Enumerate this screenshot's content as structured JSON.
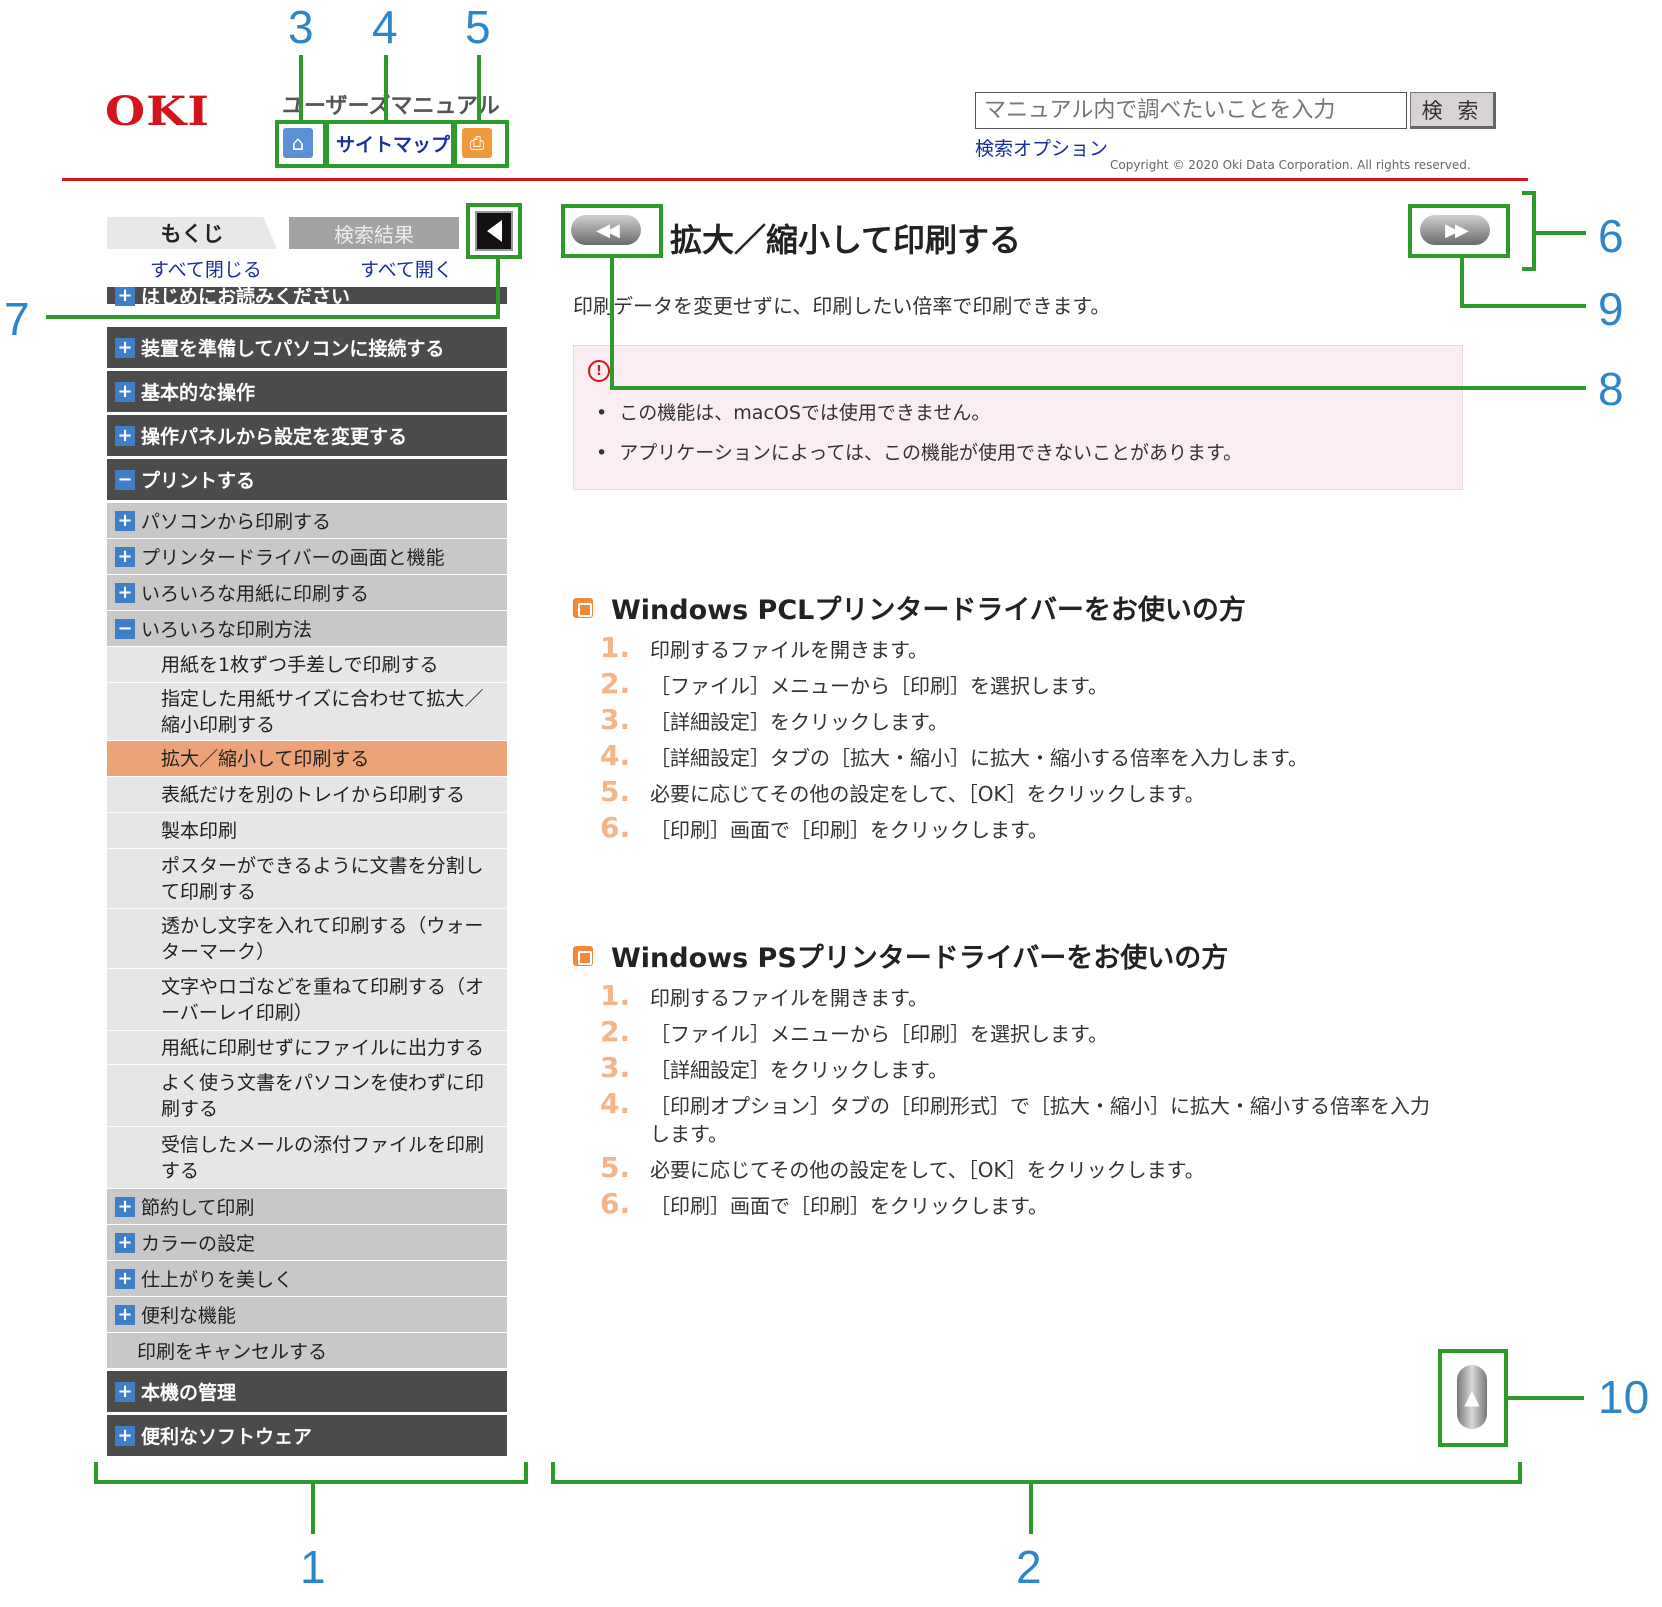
{
  "header": {
    "logo": "OKI",
    "manual_title": "ユーザーズマニュアル",
    "home_icon": "home-icon",
    "sitemap": "サイトマップ",
    "print_icon": "print-icon",
    "search_placeholder": "マニュアル内で調べたいことを入力",
    "search_button": "検 索",
    "search_options": "検索オプション",
    "copyright": "Copyright © 2020 Oki Data Corporation. All rights reserved."
  },
  "sidebar": {
    "tab_toc": "もくじ",
    "tab_search": "検索結果",
    "close_all": "すべて閉じる",
    "open_all": "すべて開く",
    "items": [
      {
        "level": 1,
        "exp": "+",
        "label": "はじめにお読みください"
      },
      {
        "level": 1,
        "exp": "+",
        "label": "装置を準備してパソコンに接続する"
      },
      {
        "level": 1,
        "exp": "+",
        "label": "基本的な操作"
      },
      {
        "level": 1,
        "exp": "+",
        "label": "操作パネルから設定を変更する"
      },
      {
        "level": 1,
        "exp": "−",
        "label": "プリントする"
      },
      {
        "level": 2,
        "exp": "+",
        "label": "パソコンから印刷する"
      },
      {
        "level": 2,
        "exp": "+",
        "label": "プリンタードライバーの画面と機能"
      },
      {
        "level": 2,
        "exp": "+",
        "label": "いろいろな用紙に印刷する"
      },
      {
        "level": 2,
        "exp": "−",
        "label": "いろいろな印刷方法"
      },
      {
        "level": 3,
        "label": "用紙を1枚ずつ手差しで印刷する"
      },
      {
        "level": 3,
        "label": "指定した用紙サイズに合わせて拡大／縮小印刷する"
      },
      {
        "level": 3,
        "label": "拡大／縮小して印刷する",
        "active": true
      },
      {
        "level": 3,
        "label": "表紙だけを別のトレイから印刷する"
      },
      {
        "level": 3,
        "label": "製本印刷"
      },
      {
        "level": 3,
        "label": "ポスターができるように文書を分割して印刷する"
      },
      {
        "level": 3,
        "label": "透かし文字を入れて印刷する（ウォーターマーク）"
      },
      {
        "level": 3,
        "label": "文字やロゴなどを重ねて印刷する（オーバーレイ印刷）"
      },
      {
        "level": 3,
        "label": "用紙に印刷せずにファイルに出力する"
      },
      {
        "level": 3,
        "label": "よく使う文書をパソコンを使わずに印刷する"
      },
      {
        "level": 3,
        "label": "受信したメールの添付ファイルを印刷する"
      },
      {
        "level": 2,
        "exp": "+",
        "label": "節約して印刷"
      },
      {
        "level": 2,
        "exp": "+",
        "label": "カラーの設定"
      },
      {
        "level": 2,
        "exp": "+",
        "label": "仕上がりを美しく"
      },
      {
        "level": 2,
        "exp": "+",
        "label": "便利な機能"
      },
      {
        "level": 2,
        "label": "印刷をキャンセルする"
      },
      {
        "level": 1,
        "exp": "+",
        "label": "本機の管理"
      },
      {
        "level": 1,
        "exp": "+",
        "label": "便利なソフトウェア"
      }
    ]
  },
  "main": {
    "title": "拡大／縮小して印刷する",
    "intro": "印刷データを変更せずに、印刷したい倍率で印刷できます。",
    "notes": [
      "この機能は、macOSでは使用できません。",
      "アプリケーションによっては、この機能が使用できないことがあります。"
    ],
    "sections": [
      {
        "heading": "Windows PCLプリンタードライバーをお使いの方",
        "steps": [
          {
            "num": "1.",
            "text": "印刷するファイルを開きます。"
          },
          {
            "num": "2.",
            "text": "［ファイル］メニューから［印刷］を選択します。"
          },
          {
            "num": "3.",
            "text": "［詳細設定］をクリックします。"
          },
          {
            "num": "4.",
            "text": "［詳細設定］タブの［拡大・縮小］に拡大・縮小する倍率を入力します。"
          },
          {
            "num": "5.",
            "text": "必要に応じてその他の設定をして、［OK］をクリックします。"
          },
          {
            "num": "6.",
            "text": "［印刷］画面で［印刷］をクリックします。"
          }
        ]
      },
      {
        "heading": "Windows PSプリンタードライバーをお使いの方",
        "steps": [
          {
            "num": "1.",
            "text": "印刷するファイルを開きます。"
          },
          {
            "num": "2.",
            "text": "［ファイル］メニューから［印刷］を選択します。"
          },
          {
            "num": "3.",
            "text": "［詳細設定］をクリックします。"
          },
          {
            "num": "4.",
            "text": "［印刷オプション］タブの［印刷形式］で［拡大・縮小］に拡大・縮小する倍率を入力します。"
          },
          {
            "num": "5.",
            "text": "必要に応じてその他の設定をして、［OK］をクリックします。"
          },
          {
            "num": "6.",
            "text": "［印刷］画面で［印刷］をクリックします。"
          }
        ]
      }
    ]
  },
  "callouts": [
    "1",
    "2",
    "3",
    "4",
    "5",
    "6",
    "7",
    "8",
    "9",
    "10"
  ],
  "colors": {
    "accent": "#2e9a2e",
    "callout": "#2e86c9",
    "brand": "#d4141b",
    "active": "#eba377"
  }
}
